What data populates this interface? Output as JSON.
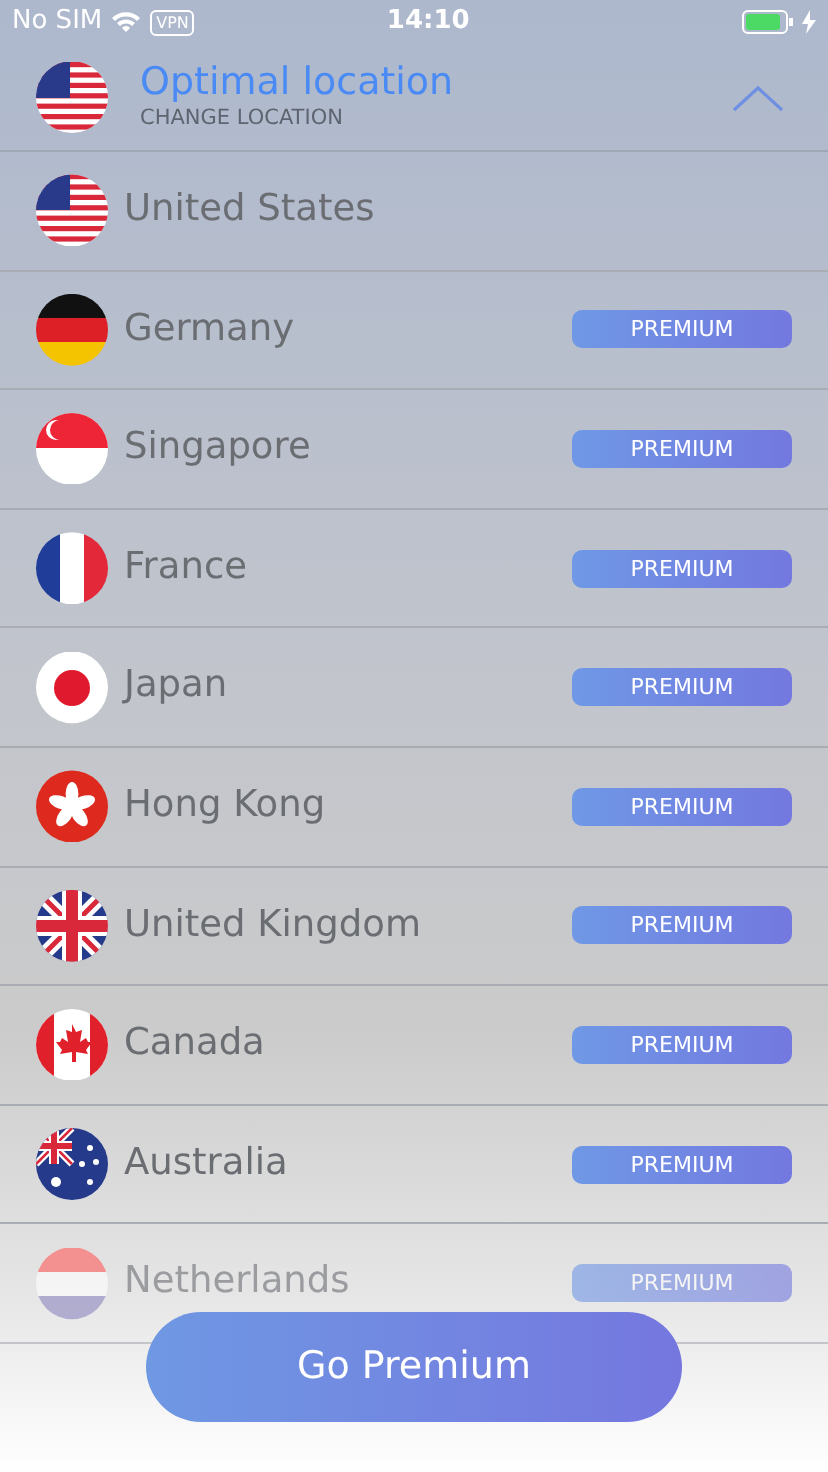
{
  "status_bar": {
    "carrier": "No SIM",
    "vpn": "VPN",
    "time": "14:10"
  },
  "header": {
    "title": "Optimal location",
    "subtitle": "CHANGE LOCATION",
    "expanded": true
  },
  "locations": [
    {
      "name": "United States"
    },
    {
      "name": "Germany",
      "badge": "PREMIUM"
    },
    {
      "name": "Singapore",
      "badge": "PREMIUM"
    },
    {
      "name": "France",
      "badge": "PREMIUM"
    },
    {
      "name": "Japan",
      "badge": "PREMIUM"
    },
    {
      "name": "Hong Kong",
      "badge": "PREMIUM"
    },
    {
      "name": "United Kingdom",
      "badge": "PREMIUM"
    },
    {
      "name": "Canada",
      "badge": "PREMIUM"
    },
    {
      "name": "Australia",
      "badge": "PREMIUM"
    },
    {
      "name": "Netherlands",
      "badge": "PREMIUM"
    }
  ],
  "action_button": "Go Premium"
}
